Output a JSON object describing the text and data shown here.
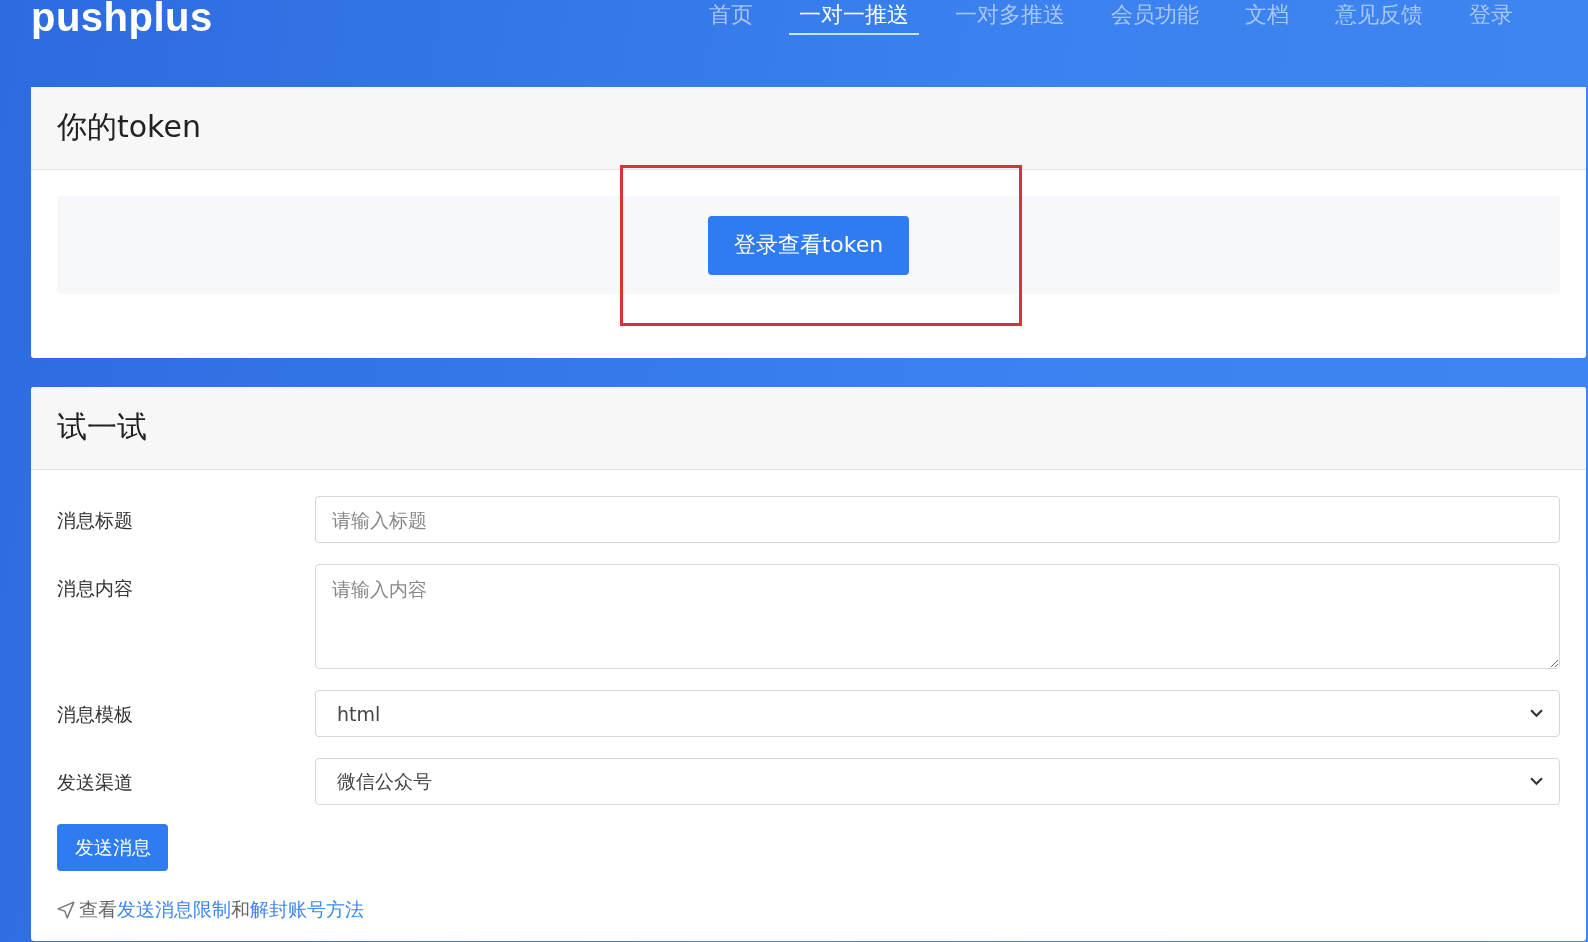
{
  "header": {
    "logo": "pushplus",
    "nav": [
      {
        "label": "首页",
        "selected": false
      },
      {
        "label": "一对一推送",
        "selected": true
      },
      {
        "label": "一对多推送",
        "selected": false
      },
      {
        "label": "会员功能",
        "selected": false
      },
      {
        "label": "文档",
        "selected": false
      },
      {
        "label": "意见反馈",
        "selected": false
      },
      {
        "label": "登录",
        "selected": false
      }
    ]
  },
  "token_card": {
    "title": "你的token",
    "button": "登录查看token",
    "highlighted": true
  },
  "try_card": {
    "title": "试一试",
    "fields": [
      {
        "kind": "input",
        "label": "消息标题",
        "placeholder": "请输入标题"
      },
      {
        "kind": "textarea",
        "label": "消息内容",
        "placeholder": "请输入内容"
      },
      {
        "kind": "select",
        "label": "消息模板",
        "value": "html"
      },
      {
        "kind": "select",
        "label": "发送渠道",
        "value": "微信公众号"
      }
    ],
    "button": "发送消息",
    "help": [
      {
        "kind": "text",
        "text": "查看"
      },
      {
        "kind": "link",
        "text": "发送消息限制"
      },
      {
        "kind": "text",
        "text": "和"
      },
      {
        "kind": "link",
        "text": "解封账号方法"
      }
    ]
  }
}
